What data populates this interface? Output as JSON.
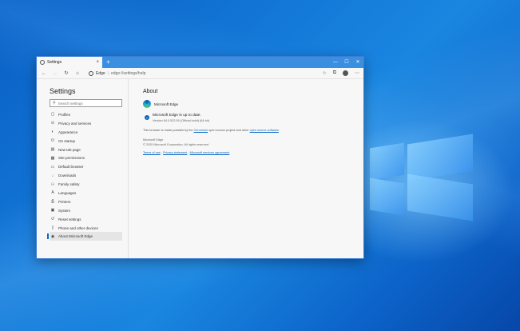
{
  "window": {
    "tab_title": "Settings",
    "tab_close": "×",
    "new_tab": "+",
    "minimize": "—",
    "maximize": "☐",
    "close": "✕"
  },
  "toolbar": {
    "back": "←",
    "forward": "→",
    "refresh": "↻",
    "home": "⌂",
    "site_label": "Edge",
    "separator": "|",
    "url": "edge://settings/help",
    "favorite": "☆",
    "collections": "⧉",
    "menu": "⋯"
  },
  "sidebar": {
    "title": "Settings",
    "search_placeholder": "Search settings",
    "items": [
      {
        "label": "Profiles",
        "icon": "▢"
      },
      {
        "label": "Privacy and services",
        "icon": "⊙"
      },
      {
        "label": "Appearance",
        "icon": "◐"
      },
      {
        "label": "On startup",
        "icon": "⏻"
      },
      {
        "label": "New tab page",
        "icon": "▤"
      },
      {
        "label": "Site permissions",
        "icon": "▦"
      },
      {
        "label": "Default browser",
        "icon": "▭"
      },
      {
        "label": "Downloads",
        "icon": "↓"
      },
      {
        "label": "Family safety",
        "icon": "⚇"
      },
      {
        "label": "Languages",
        "icon": "A"
      },
      {
        "label": "Printers",
        "icon": "⎙"
      },
      {
        "label": "System",
        "icon": "▣"
      },
      {
        "label": "Reset settings",
        "icon": "↺"
      },
      {
        "label": "Phone and other devices",
        "icon": "▯"
      },
      {
        "label": "About Microsoft Edge",
        "icon": "◉"
      }
    ]
  },
  "about": {
    "heading": "About",
    "product": "Microsoft Edge",
    "status": "Microsoft Edge is up to date.",
    "version": "Version 84.0.522.59 (Official build) (64-bit)",
    "credit_pre": "This browser is made possible by the",
    "credit_link1": "Chromium",
    "credit_mid": "open source project and other",
    "credit_link2": "open source software",
    "credit_end": ".",
    "brand": "Microsoft Edge",
    "copyright": "© 2020 Microsoft Corporation. All rights reserved.",
    "terms": "Terms of use",
    "privacy": "Privacy statement",
    "agreement": "Microsoft services agreement",
    "link_sep": " - "
  }
}
